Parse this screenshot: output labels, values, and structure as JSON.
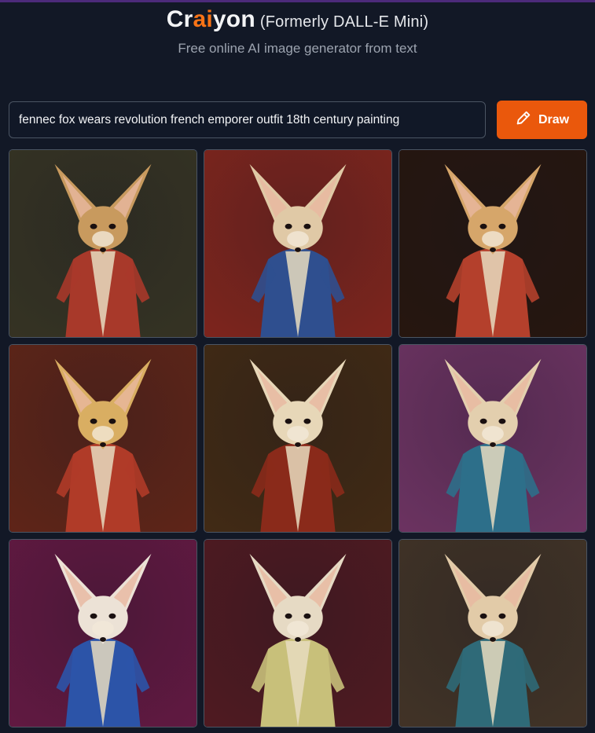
{
  "header": {
    "brand_pre": "Cr",
    "brand_ai": "ai",
    "brand_post": "yon",
    "subtitle": "(Formerly DALL-E Mini)",
    "tagline": "Free online AI image generator from text"
  },
  "prompt": {
    "value": "fennec fox wears revolution french emporer outfit 18th century painting"
  },
  "draw_button": {
    "label": "Draw",
    "icon": "pencil-icon"
  },
  "colors": {
    "background": "#121826",
    "accent": "#f97316",
    "button": "#ea580c"
  },
  "images": [
    {
      "bg": "#3d3a28",
      "fox": "#c89a5e",
      "coat": "#a8392a"
    },
    {
      "bg": "#8e2a22",
      "fox": "#e0c9a6",
      "coat": "#2f4f8f"
    },
    {
      "bg": "#2c1a12",
      "fox": "#d6a66a",
      "coat": "#b4402c"
    },
    {
      "bg": "#6b2a1c",
      "fox": "#d9ae62",
      "coat": "#b03b28"
    },
    {
      "bg": "#4a3018",
      "fox": "#e7d7b8",
      "coat": "#8a2a1a"
    },
    {
      "bg": "#7a3a6e",
      "fox": "#e3cfae",
      "coat": "#2d6f8a"
    },
    {
      "bg": "#6e1d4a",
      "fox": "#ece2d6",
      "coat": "#2c54a8"
    },
    {
      "bg": "#5a1e26",
      "fox": "#e6dac4",
      "coat": "#c8c07a"
    },
    {
      "bg": "#4a3a2c",
      "fox": "#e2cba8",
      "coat": "#2f6a78"
    }
  ]
}
